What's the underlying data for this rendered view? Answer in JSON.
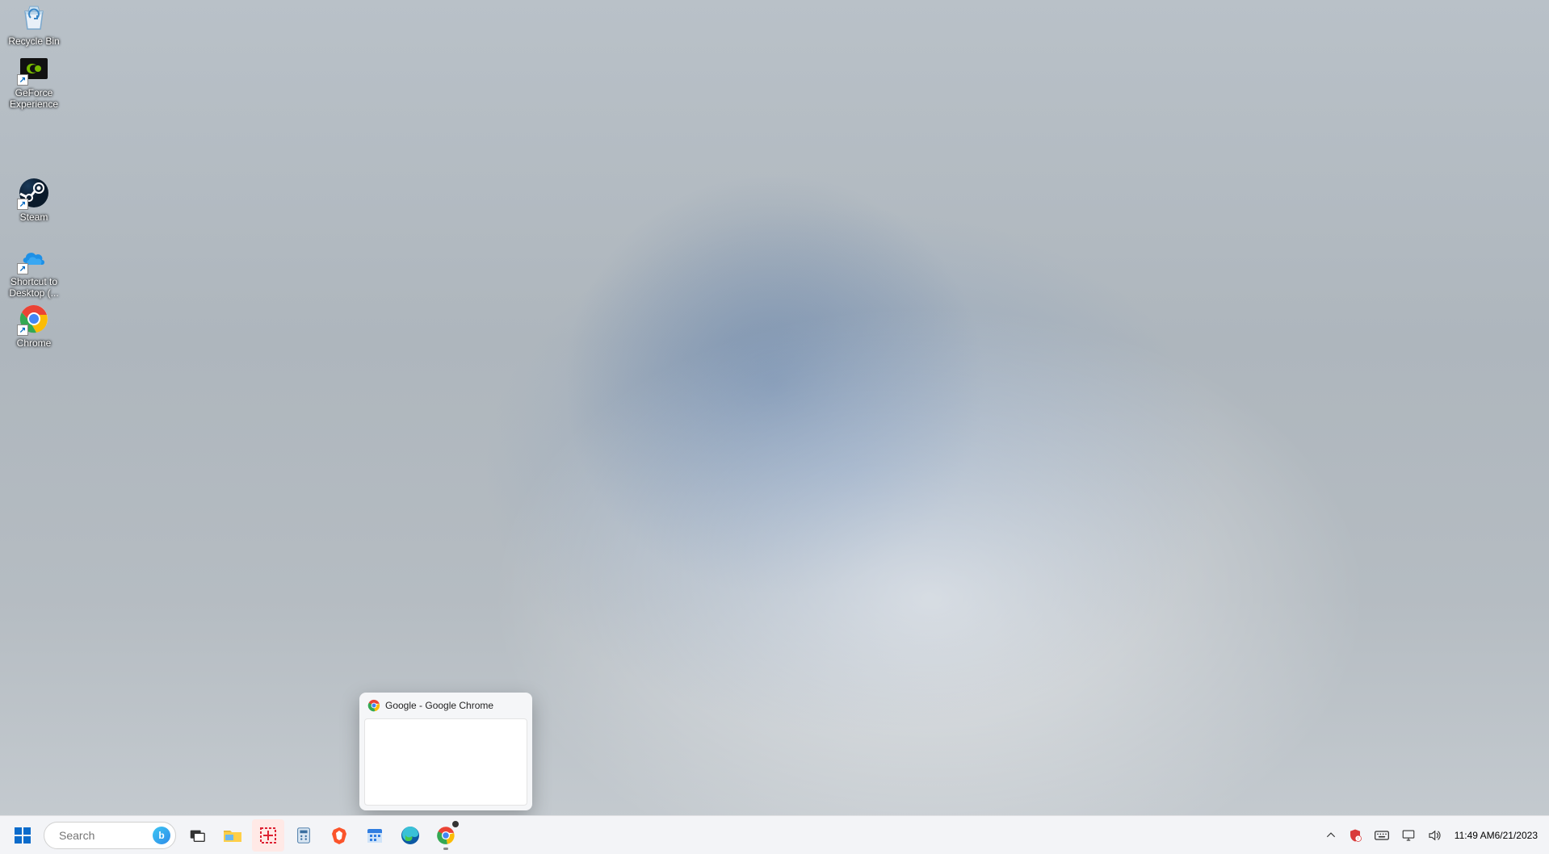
{
  "desktop_icons": [
    {
      "id": "recycle-bin",
      "label": "Recycle Bin",
      "shortcut": false
    },
    {
      "id": "geforce",
      "label": "GeForce Experience",
      "shortcut": true
    },
    {
      "id": "steam",
      "label": "Steam",
      "shortcut": true
    },
    {
      "id": "shortcut-desktop",
      "label": "Shortcut to Desktop (...",
      "shortcut": true
    },
    {
      "id": "chrome",
      "label": "Chrome",
      "shortcut": true
    }
  ],
  "search": {
    "placeholder": "Search"
  },
  "thumbnail": {
    "title": "Google - Google Chrome"
  },
  "taskbar_apps": [
    {
      "id": "start",
      "name": "start-button"
    },
    {
      "id": "task-view",
      "name": "task-view-button"
    },
    {
      "id": "file-explorer",
      "name": "file-explorer-button"
    },
    {
      "id": "snip",
      "name": "snipping-tool-button"
    },
    {
      "id": "calculator",
      "name": "calculator-button"
    },
    {
      "id": "brave",
      "name": "brave-browser-button"
    },
    {
      "id": "calendar",
      "name": "calendar-button"
    },
    {
      "id": "edge",
      "name": "edge-browser-button"
    },
    {
      "id": "chrome",
      "name": "chrome-browser-button"
    }
  ],
  "clock": {
    "time": "11:49 AM",
    "date": "6/21/2023"
  }
}
